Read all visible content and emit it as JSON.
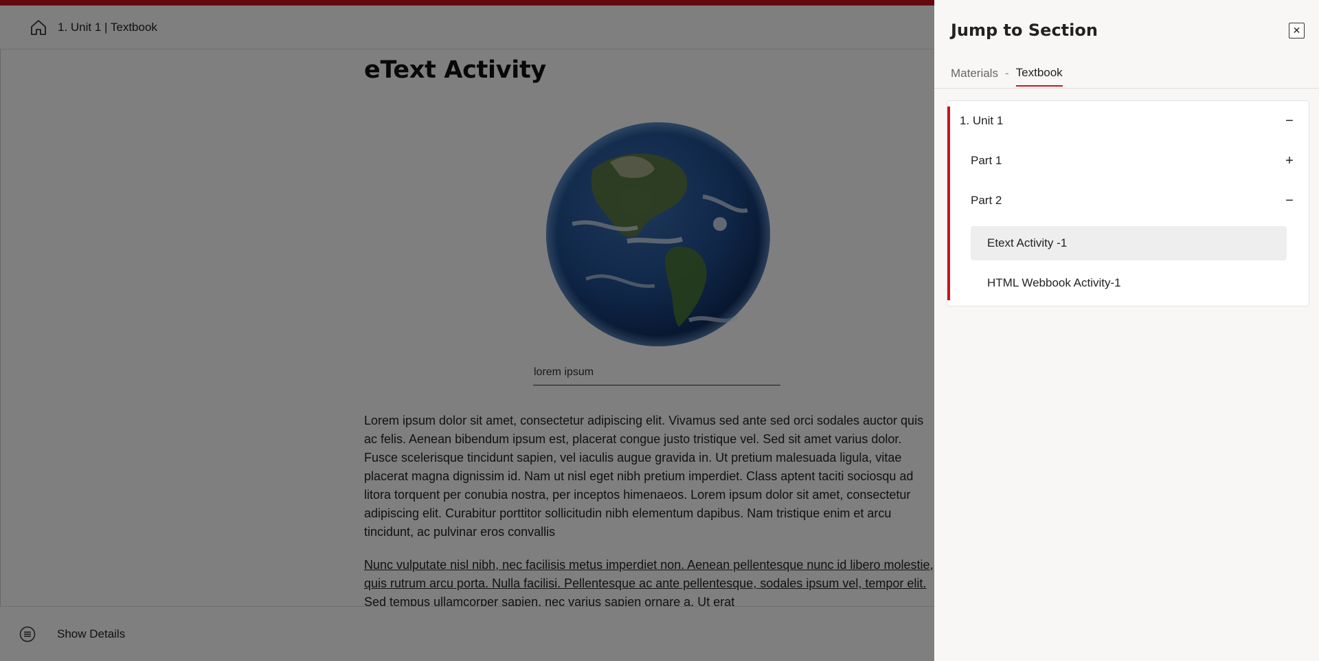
{
  "header": {
    "breadcrumb": "1. Unit 1 | Textbook",
    "home_icon": "home-icon"
  },
  "article": {
    "title": "eText Activity",
    "image": "earth-globe",
    "caption": "lorem ipsum",
    "paragraph": "Lorem ipsum dolor sit amet, consectetur adipiscing elit. Vivamus sed ante sed orci sodales auctor quis ac felis. Aenean bibendum ipsum est, placerat congue justo tristique vel. Sed sit amet varius dolor. Fusce scelerisque tincidunt sapien, vel iaculis augue gravida in. Ut pretium malesuada ligula, vitae placerat magna dignissim id. Nam ut nisl eget nibh pretium imperdiet. Class aptent taciti sociosqu ad litora torquent per conubia nostra, per inceptos himenaeos. Lorem ipsum dolor sit amet, consectetur adipiscing elit. Curabitur porttitor sollicitudin nibh elementum dapibus. Nam tristique enim et arcu tincidunt, ac pulvinar eros convallis",
    "link_paragraph": "Nunc vulputate nisl nibh, nec facilisis metus imperdiet non. Aenean pellentesque nunc id libero molestie, quis rutrum arcu porta. Nulla facilisi. Pellentesque ac ante pellentesque, sodales ipsum vel, tempor elit. Sed tempus ullamcorper sapien, nec varius sapien ornare a. Ut erat"
  },
  "footer": {
    "details_label": "Show Details",
    "details_icon": "list-circle-icon"
  },
  "panel": {
    "title": "Jump to Section",
    "close_glyph": "✕",
    "tabs": [
      {
        "label": "Materials",
        "active": false
      },
      {
        "label": "Textbook",
        "active": true
      }
    ],
    "tab_separator": "-",
    "tree": {
      "unit": {
        "label": "1. Unit 1",
        "toggle": "−"
      },
      "parts": [
        {
          "label": "Part 1",
          "toggle": "+"
        },
        {
          "label": "Part 2",
          "toggle": "−"
        }
      ],
      "items": [
        {
          "label": "Etext Activity -1",
          "selected": true
        },
        {
          "label": "HTML Webbook Activity-1",
          "selected": false
        }
      ]
    }
  },
  "colors": {
    "accent": "#c8141e",
    "overlay": "rgba(0,0,0,0.5)",
    "panel_bg": "#f8f7f5"
  }
}
